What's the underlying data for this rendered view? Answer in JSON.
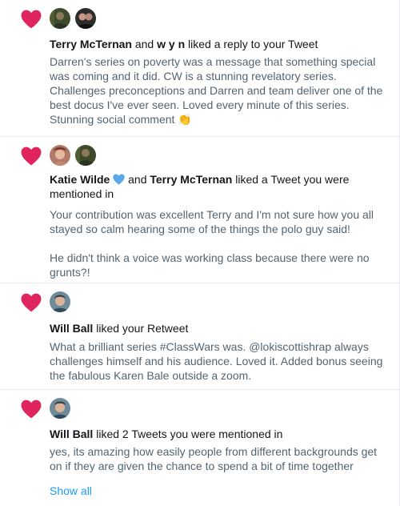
{
  "notifications": [
    {
      "actor1": "Terry McTernan",
      "connector": " and ",
      "actor2": "w y n",
      "action": " liked a reply to your Tweet",
      "text": "Darren's series on poverty was a message that something special was coming and it did. CW is a stunning revelatory series. Challenges preconceptions and Darren and team deliver one of the best docus I've ever seen. Loved every minute of this series. Stunning social comment",
      "emoji": "👏"
    },
    {
      "actor1": "Katie Wilde",
      "connector": " and ",
      "actor2": "Terry McTernan",
      "action": " liked a Tweet you were mentioned in",
      "text1": "Your contribution was excellent Terry and I'm not sure how you all stayed so calm hearing some of the things the polo guy said!",
      "text2": "He didn't think a voice was working class because there were no grunts?!"
    },
    {
      "actor1": "Will Ball",
      "action": " liked your Retweet",
      "text": "What a brilliant series #ClassWars was. @lokiscottishrap always challenges himself and his audience.  Loved it. Added bonus seeing the fabulous Karen Bale outside a zoom."
    },
    {
      "actor1": "Will Ball",
      "action": " liked 2 Tweets you were mentioned in",
      "text": "yes, its amazing how easily people from different backgrounds get on if they are given the chance to spend a bit of time together",
      "show_all": "Show all"
    }
  ],
  "colors": {
    "heart": "#e0245e",
    "link": "#1d9bf0",
    "muted_text": "#536471",
    "blue_heart": "#5ba8e8"
  },
  "icons": {
    "like": "heart-icon",
    "blue_heart": "blue-heart-icon",
    "clap": "clapping-hands-emoji"
  }
}
